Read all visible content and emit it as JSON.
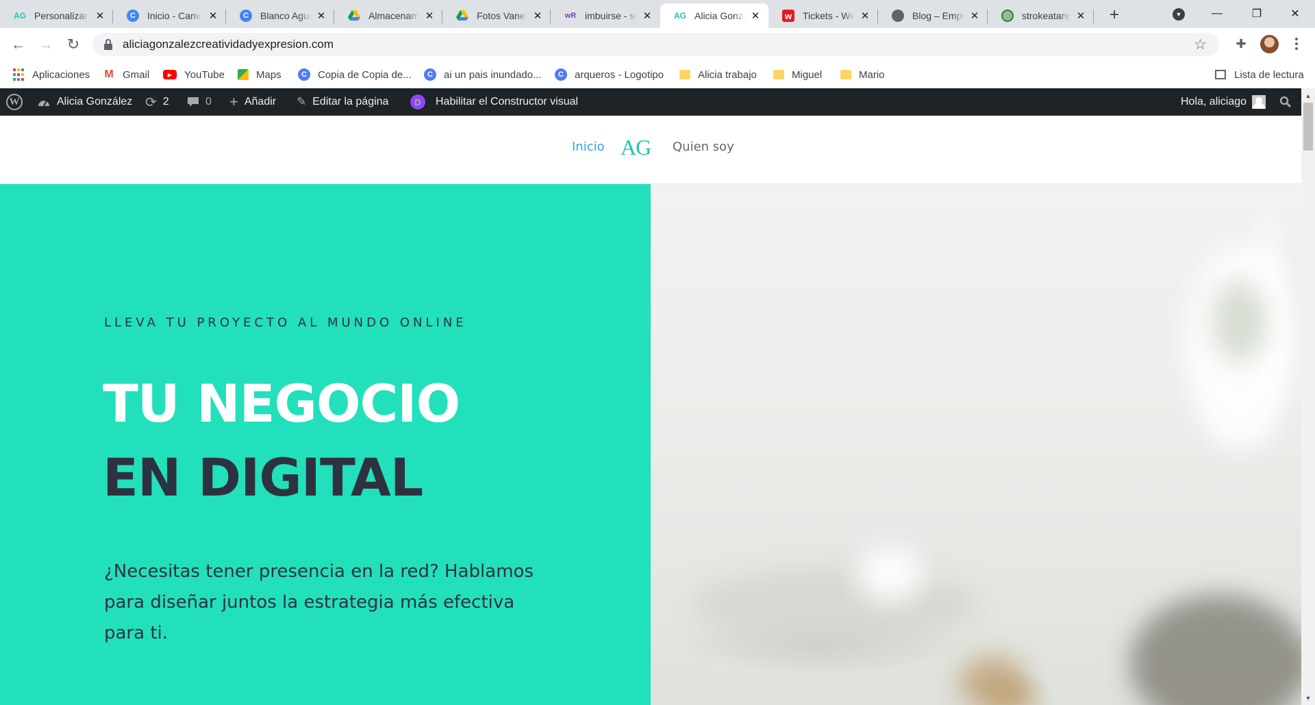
{
  "browser": {
    "tabs": [
      {
        "title": "Personalizar",
        "favicon": "ag-icon",
        "active": false
      },
      {
        "title": "Inicio - Canva",
        "favicon": "canva-icon",
        "active": false
      },
      {
        "title": "Blanco Aguamarina",
        "favicon": "canva-icon",
        "active": false
      },
      {
        "title": "Almacenamiento",
        "favicon": "google-drive-icon",
        "active": false
      },
      {
        "title": "Fotos Vanesa",
        "favicon": "google-drive-icon",
        "active": false
      },
      {
        "title": "imbuirse - sinónimos",
        "favicon": "wordreference-icon",
        "active": false
      },
      {
        "title": "Alicia González",
        "favicon": "ag-icon",
        "active": true
      },
      {
        "title": "Tickets - WeTransfer",
        "favicon": "tickets-icon",
        "active": false
      },
      {
        "title": "Blog – Empresa",
        "favicon": "globe-icon",
        "active": false
      },
      {
        "title": "strokeatang",
        "favicon": "stroke-icon",
        "active": false
      }
    ],
    "url": "aliciagonzalezcreatividadyexpresion.com",
    "bookmarks": [
      {
        "label": "Aplicaciones",
        "icon": "apps-grid-icon"
      },
      {
        "label": "Gmail",
        "icon": "gmail-icon"
      },
      {
        "label": "YouTube",
        "icon": "youtube-icon"
      },
      {
        "label": "Maps",
        "icon": "maps-icon"
      },
      {
        "label": "Copia de Copia de...",
        "icon": "canva-icon"
      },
      {
        "label": "ai un pais inundado...",
        "icon": "canva-icon"
      },
      {
        "label": "arqueros - Logotipo",
        "icon": "canva-icon"
      },
      {
        "label": "Alicia trabajo",
        "icon": "folder-icon"
      },
      {
        "label": "Miguel",
        "icon": "folder-icon"
      },
      {
        "label": "Mario",
        "icon": "folder-icon"
      }
    ],
    "reading_list": "Lista de lectura"
  },
  "adminbar": {
    "site_name": "Alicia González",
    "updates_count": "2",
    "comments_count": "0",
    "add_new": "Añadir",
    "edit_page": "Editar la página",
    "visual_builder": "Habilitar el Constructor visual",
    "greeting": "Hola, aliciago"
  },
  "site": {
    "nav": [
      {
        "label": "Inicio",
        "current": true
      },
      {
        "label": "Quien soy",
        "current": false
      }
    ],
    "logo_text": "AG"
  },
  "hero": {
    "eyebrow": "LLEVA TU PROYECTO AL MUNDO ONLINE",
    "headline_line1": "TU NEGOCIO",
    "headline_line2": "EN DIGITAL",
    "body": "¿Necesitas tener presencia en la red? Hablamos para diseñar juntos la estrategia más efectiva para ti."
  },
  "colors": {
    "accent_turquoise": "#22e0bb",
    "dark_text": "#2e3240",
    "link_blue": "#2ea3f2",
    "adminbar_bg": "#1d2327"
  }
}
